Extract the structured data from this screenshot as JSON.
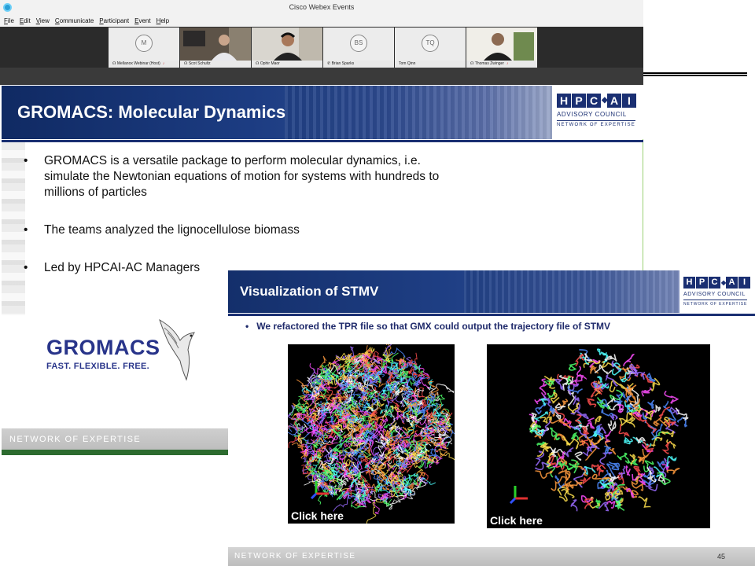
{
  "window": {
    "title": "Cisco Webex Events"
  },
  "menu": [
    {
      "label": "File",
      "key": "F"
    },
    {
      "label": "Edit",
      "key": "E"
    },
    {
      "label": "View",
      "key": "V"
    },
    {
      "label": "Communicate",
      "key": "C"
    },
    {
      "label": "Participant",
      "key": "P"
    },
    {
      "label": "Event",
      "key": "E"
    },
    {
      "label": "Help",
      "key": "H"
    }
  ],
  "participants": [
    {
      "name": "Mellanox Webinar (Host)",
      "initials": "M",
      "video": false
    },
    {
      "name": "Scot Schultz",
      "initials": "",
      "video": true
    },
    {
      "name": "Ophir Maor",
      "initials": "",
      "video": true,
      "active": true
    },
    {
      "name": "Brian Sparks",
      "initials": "BS",
      "video": false
    },
    {
      "name": "Tom Qinn",
      "initials": "TQ",
      "video": false
    },
    {
      "name": "Thomas Zwinger",
      "initials": "",
      "video": true
    }
  ],
  "badge": {
    "letters": [
      "H",
      "P",
      "C",
      "A",
      "I"
    ],
    "line1": "ADVISORY COUNCIL",
    "line2": "NETWORK OF EXPERTISE"
  },
  "slide1": {
    "title": "GROMACS: Molecular Dynamics",
    "bullets": [
      "GROMACS is a versatile package to perform molecular dynamics, i.e. simulate the Newtonian equations of motion for systems with hundreds to millions of particles",
      "The teams analyzed the lignocellulose biomass",
      "Led by HPCAI-AC Managers"
    ],
    "logo_word": "GROMACS",
    "logo_tagline": "FAST. FLEXIBLE. FREE.",
    "footer": "NETWORK OF EXPERTISE"
  },
  "slide2": {
    "title": "Visualization of STMV",
    "bullet": "We refactored the TPR file so that GMX could output the trajectory file of STMV",
    "viz_left_cta": "Click here",
    "viz_right_cta": "Click here",
    "footer": "NETWORK OF EXPERTISE",
    "page_number": "45"
  },
  "colors": {
    "brand_navy": "#1a2f72",
    "active_tile": "#20a8d8",
    "footer_green": "#2d6b2f"
  }
}
